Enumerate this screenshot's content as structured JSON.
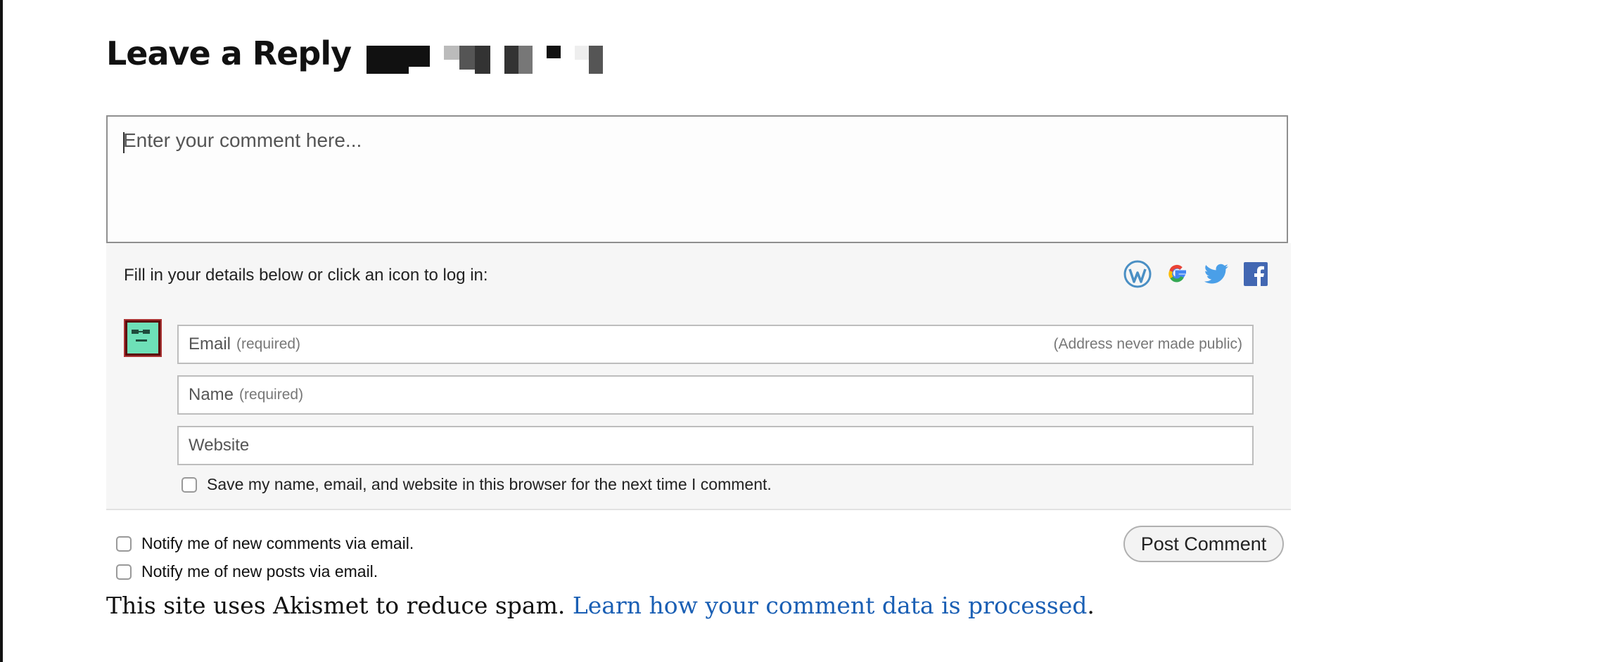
{
  "reply": {
    "title": "Leave a Reply",
    "redacted_cell_colors": [
      "#111111",
      "#111111",
      "#111111",
      "#ffffff",
      "#999999",
      "#555555",
      "#ffffff",
      "#222222",
      "#444444",
      "#ffffff",
      "#111111",
      "#ffffff",
      "#dddddd",
      "#555555"
    ]
  },
  "comment": {
    "placeholder": "Enter your comment here..."
  },
  "details": {
    "prompt": "Fill in your details below or click an icon to log in:",
    "login_icons": [
      "wordpress-icon",
      "google-icon",
      "twitter-icon",
      "facebook-icon"
    ],
    "email": {
      "label": "Email",
      "required": "(required)",
      "note": "(Address never made public)"
    },
    "name": {
      "label": "Name",
      "required": "(required)"
    },
    "website": {
      "label": "Website"
    },
    "save_label": "Save my name, email, and website in this browser for the next time I comment."
  },
  "notify": {
    "comments_label": "Notify me of new comments via email.",
    "posts_label": "Notify me of new posts via email."
  },
  "post_button": "Post Comment",
  "akismet": {
    "text": "This site uses Akismet to reduce spam. ",
    "link_text": "Learn how your comment data is processed",
    "trailing": "."
  },
  "colors": {
    "link": "#1a5fb4",
    "wordpress": "#4a8fc4",
    "twitter": "#4a9fe8",
    "facebook": "#4267b2"
  }
}
